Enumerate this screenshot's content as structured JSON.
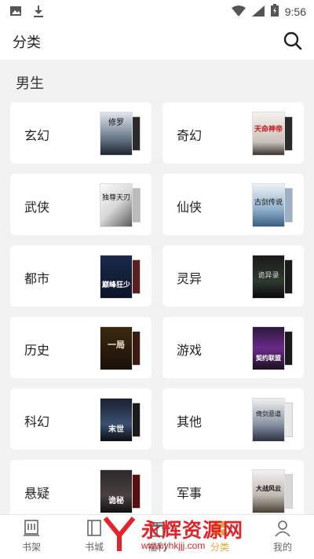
{
  "status": {
    "time": "9:56"
  },
  "appbar": {
    "title": "分类"
  },
  "section": {
    "title": "男生"
  },
  "categories": [
    {
      "label": "玄幻",
      "cover": "dark-sky"
    },
    {
      "label": "奇幻",
      "cover": "white-red"
    },
    {
      "label": "武侠",
      "cover": "ink-figure"
    },
    {
      "label": "仙侠",
      "cover": "blue-water"
    },
    {
      "label": "都市",
      "cover": "blue-night"
    },
    {
      "label": "灵异",
      "cover": "green-dark"
    },
    {
      "label": "历史",
      "cover": "dark-gold"
    },
    {
      "label": "游戏",
      "cover": "purple-armor"
    },
    {
      "label": "科幻",
      "cover": "blue-city"
    },
    {
      "label": "其他",
      "cover": "grey-figure"
    },
    {
      "label": "悬疑",
      "cover": "dark-grey"
    },
    {
      "label": "军事",
      "cover": "light-battle"
    }
  ],
  "cover_texts": [
    "修罗",
    "天命神帝",
    "独尊天刃",
    "古剑传说",
    "巅峰狂少",
    "诡异录",
    "一局",
    "契约联盟",
    "末世",
    "倚剑意道",
    "诡秘",
    "大战风云"
  ],
  "tabs": [
    {
      "label": "书架",
      "icon": "shelf-icon",
      "active": false
    },
    {
      "label": "书城",
      "icon": "book-icon",
      "active": false
    },
    {
      "label": "福利",
      "icon": "gift-icon",
      "active": false
    },
    {
      "label": "分类",
      "icon": "category-icon",
      "active": true
    },
    {
      "label": "我的",
      "icon": "user-icon",
      "active": false
    }
  ],
  "watermark": {
    "text": "永辉资源网",
    "url": "www.yhkjjj.com"
  },
  "colors": {
    "accent": "#e8a33a",
    "watermark": "#e0242b",
    "background": "#f2f2f2"
  }
}
